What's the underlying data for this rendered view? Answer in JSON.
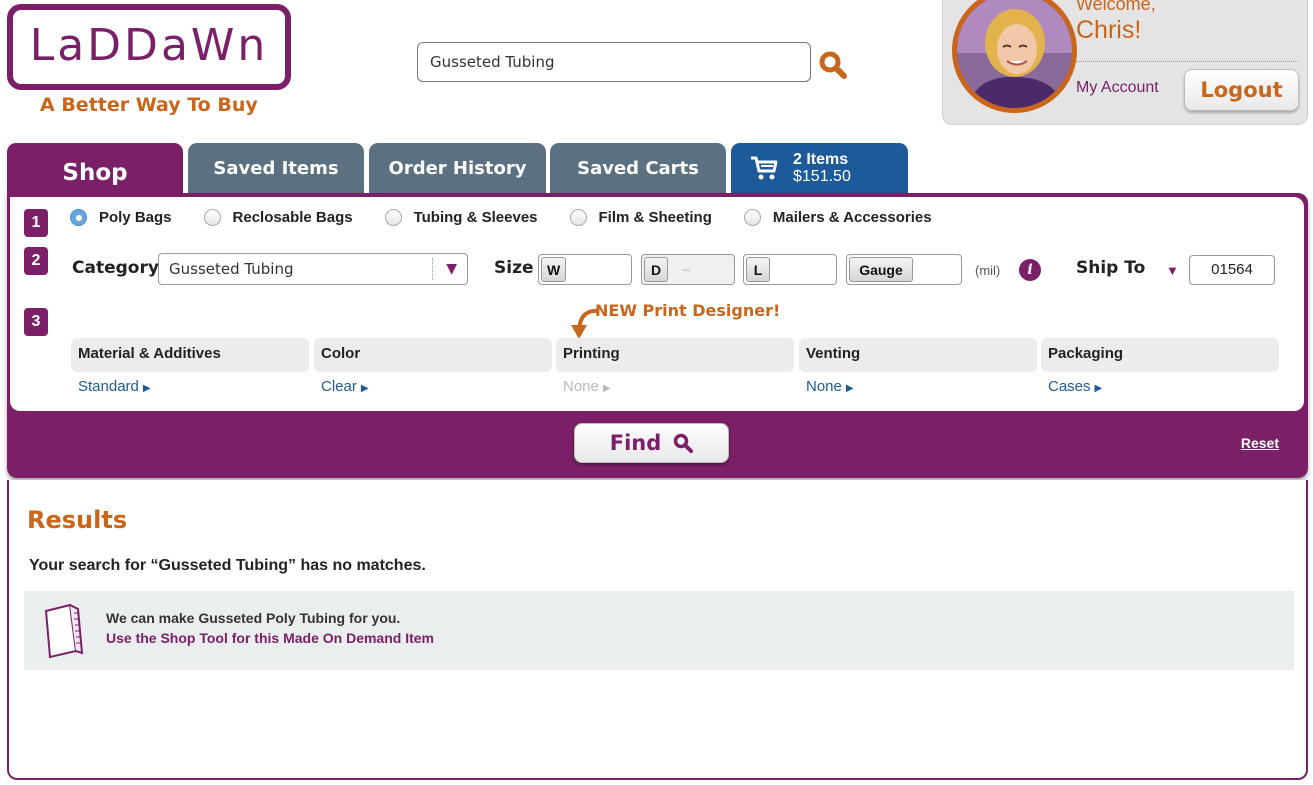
{
  "colors": {
    "brand_purple": "#7b2068",
    "accent_orange": "#c9661b",
    "tab_gray": "#5b7080",
    "cart_blue": "#1d5a99",
    "link_blue": "#1d5a99"
  },
  "header": {
    "logo_text": "LaDDaWn",
    "tagline": "A Better Way To Buy",
    "search": {
      "value": "Gusseted Tubing",
      "icon": "search-icon"
    }
  },
  "account": {
    "welcome": "Welcome,",
    "name": "Chris!",
    "my_account": "My Account",
    "logout": "Logout"
  },
  "tabs": {
    "shop": "Shop",
    "saved_items": "Saved Items",
    "order_history": "Order History",
    "saved_carts": "Saved Carts",
    "cart": {
      "count": "2 Items",
      "total": "$151.50",
      "icon": "cart-icon"
    }
  },
  "steps": {
    "one": "1",
    "two": "2",
    "three": "3"
  },
  "product_types": [
    {
      "label": "Poly Bags",
      "selected": true
    },
    {
      "label": "Reclosable Bags",
      "selected": false
    },
    {
      "label": "Tubing & Sleeves",
      "selected": false
    },
    {
      "label": "Film & Sheeting",
      "selected": false
    },
    {
      "label": "Mailers & Accessories",
      "selected": false
    }
  ],
  "filters": {
    "category_label": "Category",
    "category_value": "Gusseted Tubing",
    "size_label": "Size",
    "w_label": "W",
    "d_label": "D",
    "d_placeholder": "--",
    "l_label": "L",
    "gauge_label": "Gauge",
    "mil": "(mil)",
    "info_icon": "info-icon",
    "ship_to_label": "Ship To",
    "zip": "01564"
  },
  "options": {
    "new_print_designer": "NEW Print Designer!",
    "columns": [
      {
        "head": "Material & Additives",
        "value": "Standard",
        "enabled": true
      },
      {
        "head": "Color",
        "value": "Clear",
        "enabled": true
      },
      {
        "head": "Printing",
        "value": "None",
        "enabled": false
      },
      {
        "head": "Venting",
        "value": "None",
        "enabled": true
      },
      {
        "head": "Packaging",
        "value": "Cases",
        "enabled": true
      }
    ]
  },
  "actions": {
    "find": "Find",
    "reset": "Reset"
  },
  "results": {
    "title": "Results",
    "no_match": "Your search for  “Gusseted Tubing” has no matches.",
    "made_line1": "We can make Gusseted Poly Tubing for you.",
    "made_line2": "Use the Shop Tool for this Made On Demand Item"
  }
}
